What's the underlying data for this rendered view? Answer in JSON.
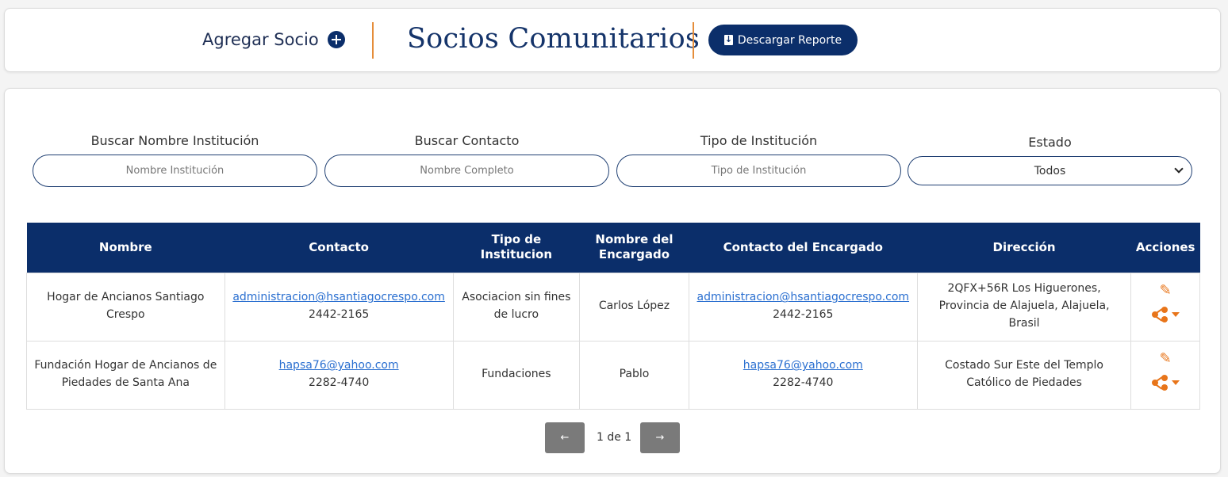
{
  "header": {
    "add_member_label": "Agregar Socio",
    "title": "Socios Comunitarios",
    "download_label": "Descargar Reporte"
  },
  "filters": {
    "name": {
      "label": "Buscar Nombre Institución",
      "placeholder": "Nombre Institución",
      "value": ""
    },
    "contact": {
      "label": "Buscar Contacto",
      "placeholder": "Nombre Completo",
      "value": ""
    },
    "type": {
      "label": "Tipo de Institución",
      "placeholder": "Tipo de Institución",
      "value": ""
    },
    "status": {
      "label": "Estado",
      "selected": "Todos"
    }
  },
  "table": {
    "headers": [
      "Nombre",
      "Contacto",
      "Tipo de Institucion",
      "Nombre del Encargado",
      "Contacto del Encargado",
      "Dirección",
      "Acciones"
    ],
    "rows": [
      {
        "name": "Hogar de Ancianos Santiago Crespo",
        "contact_email": "administracion@hsantiagocrespo.com",
        "contact_phone": "2442-2165",
        "type": "Asociacion sin fines de lucro",
        "manager": "Carlos López",
        "manager_email": "administracion@hsantiagocrespo.com",
        "manager_phone": "2442-2165",
        "address": "2QFX+56R Los Higuerones, Provincia de Alajuela, Alajuela, Brasil"
      },
      {
        "name": "Fundación Hogar de Ancianos de Piedades de Santa Ana",
        "contact_email": "hapsa76@yahoo.com",
        "contact_phone": "2282-4740",
        "type": "Fundaciones",
        "manager": "Pablo",
        "manager_email": "hapsa76@yahoo.com",
        "manager_phone": "2282-4740",
        "address": "Costado Sur Este del Templo Católico de Piedades"
      }
    ]
  },
  "pagination": {
    "prev": "←",
    "text": "1 de 1",
    "next": "→"
  },
  "colors": {
    "primary": "#0b2e6a",
    "accent": "#e58d3a",
    "action": "#e8751a",
    "link": "#2a6fd0"
  },
  "icons": {
    "add": "plus-circle-icon",
    "download": "file-download-icon",
    "edit": "pencil-icon",
    "share": "share-icon"
  }
}
